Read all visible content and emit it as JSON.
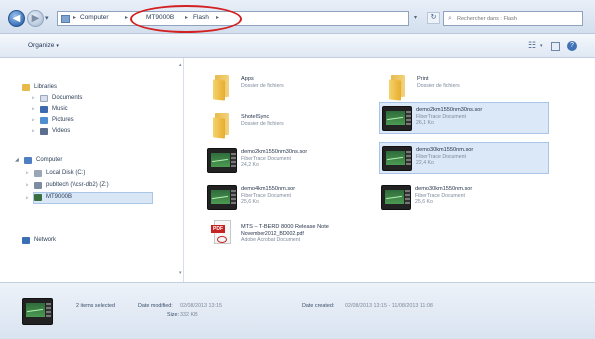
{
  "address": {
    "recent_arrow": "▾",
    "crumbs": [
      "Computer",
      "MT9000B",
      "Flash"
    ],
    "dropdown": "▾",
    "refresh": "↻",
    "search_placeholder": "Rechercher dans : Flash"
  },
  "toolbar": {
    "organize_label": "Organize",
    "organize_arrow": "▾",
    "view_icon": "☷",
    "view_arrow": "▾",
    "help_label": "?"
  },
  "sidebar": {
    "libraries": "Libraries",
    "documents": "Documents",
    "music": "Music",
    "pictures": "Pictures",
    "videos": "Videos",
    "computer": "Computer",
    "local_disk": "Local Disk (C:)",
    "network_drive": "publtech (\\\\csr-db2) (Z:)",
    "device": "MT9000B",
    "network": "Network"
  },
  "files": [
    {
      "name": "Apps",
      "line2": "Dossier de fichiers",
      "line3": ""
    },
    {
      "name": "Print",
      "line2": "Dossier de fichiers",
      "line3": ""
    },
    {
      "name": "ShotelSync",
      "line2": "Dossier de fichiers",
      "line3": ""
    },
    {
      "name": "demo2km1550nm30ns.sor",
      "line2": "FiberTrace Document",
      "line3": "26,1 Ko"
    },
    {
      "name": "demo2km1550nm30ns.sor",
      "line2": "FiberTrace Document",
      "line3": "24,2 Ko"
    },
    {
      "name": "demo30km1550nm.sor",
      "line2": "FiberTrace Document",
      "line3": "22,4 Ko"
    },
    {
      "name": "demo4km1550nm.sor",
      "line2": "FiberTrace Document",
      "line3": "25,6 Ko"
    },
    {
      "name": "demo30km1550nm.sor",
      "line2": "FiberTrace Document",
      "line3": "25,6 Ko"
    },
    {
      "name": "MTS – T-BERD 8000 Release Note",
      "line2": "November2012_BD002.pdf",
      "line3": "Adobe Acrobat Document"
    }
  ],
  "pdf_tag": "PDF",
  "status": {
    "selected": "2 items selected",
    "modified_label": "Date modified:",
    "modified_value": "02/08/2013 13:15",
    "size_label": "Size:",
    "size_value": "332 KB",
    "created_label": "Date created:",
    "created_value": "02/08/2013 13:15 - 11/08/2013 11:08"
  }
}
